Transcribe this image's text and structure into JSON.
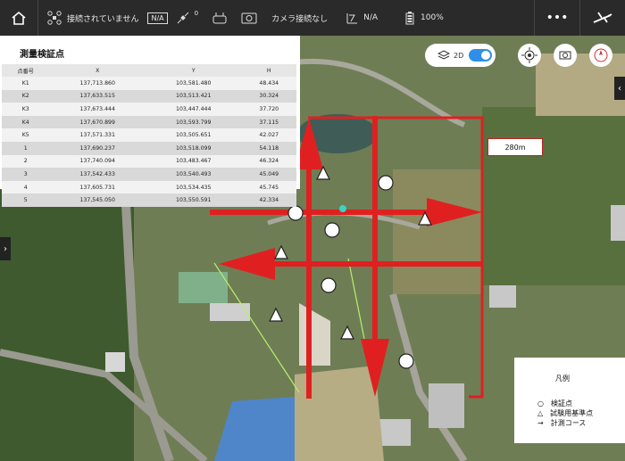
{
  "topbar": {
    "connection_status": "接続されていません",
    "na_badge": "N/A",
    "satellite_count": "0",
    "camera_status": "カメラ接続なし",
    "gps_value": "N/A",
    "battery": "100%",
    "more_label": "•••"
  },
  "map_controls": {
    "view_mode": "2D"
  },
  "panel": {
    "title": "測量検証点",
    "columns": [
      "点番号",
      "X",
      "Y",
      "H"
    ],
    "rows": [
      [
        "K1",
        "137,713.860",
        "103,581.480",
        "48.434"
      ],
      [
        "K2",
        "137,633.515",
        "103,513.421",
        "30.324"
      ],
      [
        "K3",
        "137,673.444",
        "103,447.444",
        "37.720"
      ],
      [
        "K4",
        "137,670.899",
        "103,593.799",
        "37.115"
      ],
      [
        "K5",
        "137,571.331",
        "103,505.651",
        "42.027"
      ],
      [
        "1",
        "137,690.237",
        "103,518.099",
        "54.118"
      ],
      [
        "2",
        "137,740.094",
        "103,483.467",
        "46.324"
      ],
      [
        "3",
        "137,542.433",
        "103,540.493",
        "45.049"
      ],
      [
        "4",
        "137,605.731",
        "103,534.435",
        "45.745"
      ],
      [
        "5",
        "137,545.050",
        "103,550.591",
        "42.334"
      ]
    ]
  },
  "distance_label": "280m",
  "legend": {
    "title": "凡例",
    "items": [
      {
        "symbol": "○",
        "label": "検証点"
      },
      {
        "symbol": "△",
        "label": "試験用基準点"
      },
      {
        "symbol": "→",
        "label": "計測コース"
      }
    ]
  },
  "colors": {
    "route": "#e02020",
    "topbar": "#2a2a2a",
    "toggle": "#2f8fe8"
  }
}
